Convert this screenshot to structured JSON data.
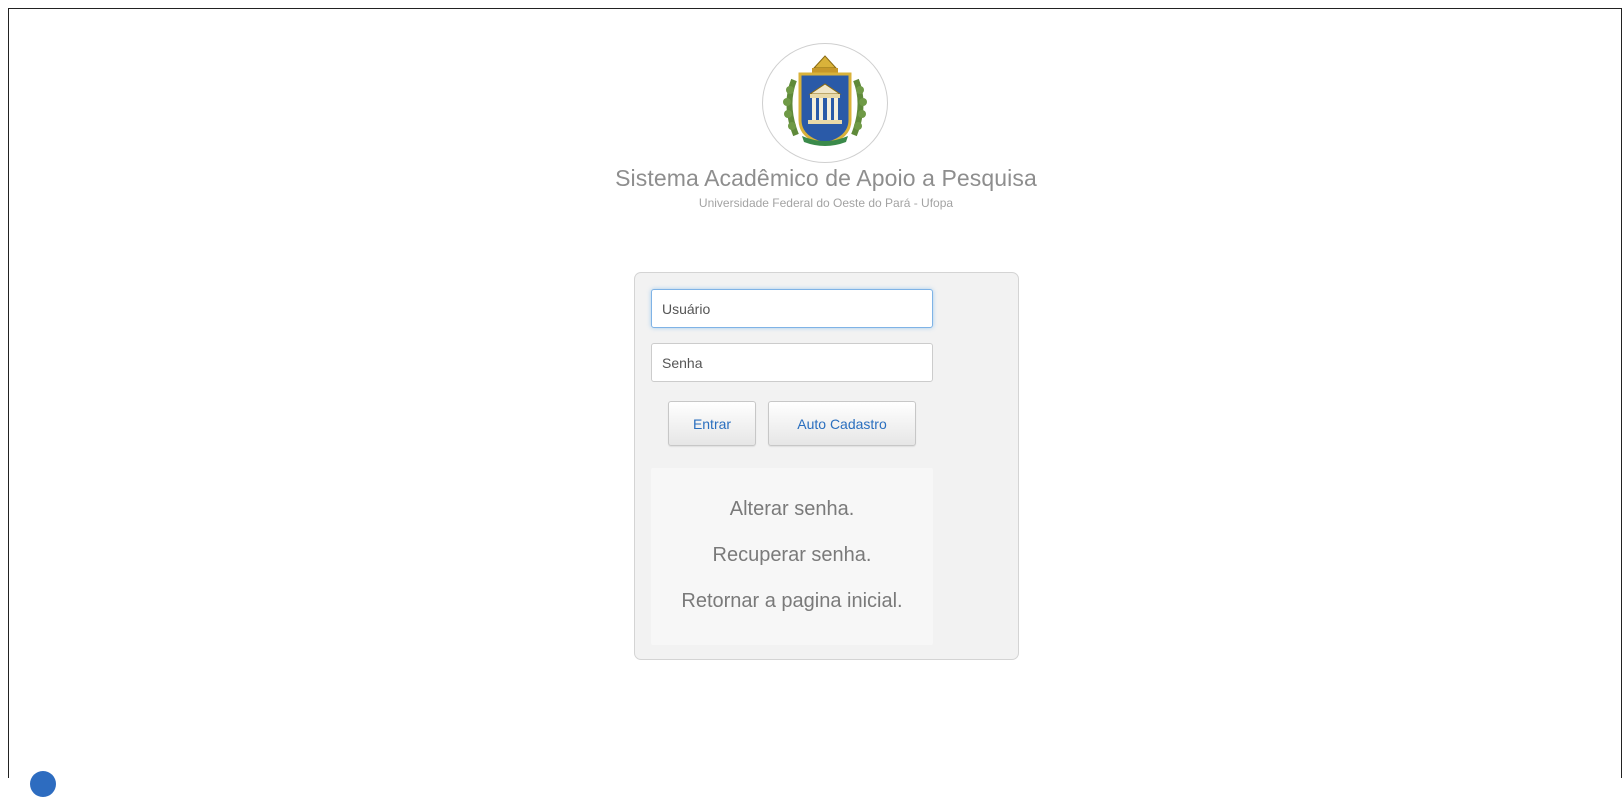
{
  "header": {
    "title": "Sistema Acadêmico de Apoio a Pesquisa",
    "subtitle": "Universidade Federal do Oeste do Pará - Ufopa",
    "logo_name": "ufopa-crest"
  },
  "login": {
    "username_placeholder": "Usuário",
    "username_value": "",
    "password_placeholder": "Senha",
    "password_value": "",
    "enter_label": "Entrar",
    "signup_label": "Auto Cadastro"
  },
  "links": {
    "change_password": "Alterar senha.",
    "recover_password": "Recuperar senha.",
    "return_home": "Retornar a pagina inicial."
  },
  "colors": {
    "title_text": "#8e8e8e",
    "button_text": "#2a6fbf",
    "panel_bg": "#f2f2f2",
    "focus_border": "#7fb3e6"
  }
}
